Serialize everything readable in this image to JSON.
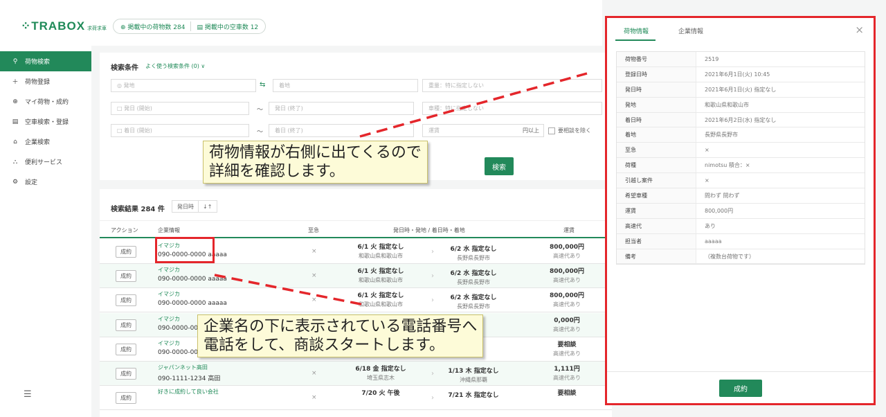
{
  "app": {
    "logo": "TRABOX",
    "logo_sub": "求荷求車"
  },
  "stats": {
    "cargo": "掲載中の荷物数 284",
    "trucks": "掲載中の空車数 12"
  },
  "sidebar": {
    "items": [
      {
        "label": "荷物検索",
        "icon": "search-icon",
        "active": true
      },
      {
        "label": "荷物登録",
        "icon": "plus-icon"
      },
      {
        "label": "マイ荷物・成約",
        "icon": "box-icon"
      },
      {
        "label": "空車検索・登録",
        "icon": "truck-icon"
      },
      {
        "label": "企業検索",
        "icon": "home-icon"
      },
      {
        "label": "便利サービス",
        "icon": "people-icon"
      },
      {
        "label": "設定",
        "icon": "gear-icon"
      }
    ]
  },
  "search": {
    "title": "検索条件",
    "saved_link": "よく使う検索条件 (0) ∨",
    "origin_ph": "◎ 発地",
    "dest_ph": "着地",
    "weight_ph": "重量：特に指定しない",
    "dep_start_ph": "□ 発日 (開始)",
    "dep_end_ph": "発日 (終了)",
    "vehicle_ph": "車種：特に指定しない",
    "arr_start_ph": "□ 着日 (開始)",
    "arr_end_ph": "着日 (終了)",
    "fare_ph": "運賃",
    "fare_unit": "円以上",
    "exclude_label": "要相談を除く",
    "search_btn": "検索",
    "tilde": "～",
    "swap": "⇆"
  },
  "results": {
    "title": "検索結果 284 件",
    "sort_label": "発日時",
    "sort_icon": "↓↑",
    "columns": {
      "action": "アクション",
      "company": "企業情報",
      "urgent": "至急",
      "route": "発日時・発地 / 着日時・着地",
      "fare": "運賃"
    },
    "rows": [
      {
        "btn": "成約",
        "company": "イマジカ",
        "phone": "090-0000-0000 aaaaa",
        "urgent": "×",
        "dep_date": "6/1 火 指定なし",
        "dep_place": "和歌山県和歌山市",
        "arr_date": "6/2 水 指定なし",
        "arr_place": "長野県長野市",
        "fare": "800,000円",
        "sub": "高速代あり"
      },
      {
        "btn": "成約",
        "company": "イマジカ",
        "phone": "090-0000-0000 aaaaa",
        "urgent": "×",
        "dep_date": "6/1 火 指定なし",
        "dep_place": "和歌山県和歌山市",
        "arr_date": "6/2 水 指定なし",
        "arr_place": "長野県長野市",
        "fare": "800,000円",
        "sub": "高速代あり"
      },
      {
        "btn": "成約",
        "company": "イマジカ",
        "phone": "090-0000-0000 aaaaa",
        "urgent": "×",
        "dep_date": "6/1 火 指定なし",
        "dep_place": "和歌山県和歌山市",
        "arr_date": "6/2 水 指定なし",
        "arr_place": "長野県長野市",
        "fare": "800,000円",
        "sub": "高速代あり"
      },
      {
        "btn": "成約",
        "company": "イマジカ",
        "phone": "090-0000-00",
        "urgent": "",
        "dep_date": "",
        "dep_place": "",
        "arr_date": "",
        "arr_place": "",
        "fare": "0,000円",
        "sub": "高速代あり"
      },
      {
        "btn": "成約",
        "company": "イマジカ",
        "phone": "090-0000-00",
        "urgent": "",
        "dep_date": "",
        "dep_place": "",
        "arr_date": "",
        "arr_place": "",
        "fare": "要相談",
        "sub": "高速代あり"
      },
      {
        "btn": "成約",
        "company": "ジャパンネット高田",
        "phone": "090-1111-1234 高田",
        "urgent": "×",
        "dep_date": "6/18 金 指定なし",
        "dep_place": "埼玉県志木",
        "arr_date": "1/13 木 指定なし",
        "arr_place": "沖縄県那覇",
        "fare": "1,111円",
        "sub": "高速代あり"
      },
      {
        "btn": "成約",
        "company": "好きに成約して良い会社",
        "phone": "",
        "urgent": "×",
        "dep_date": "7/20 火 午後",
        "dep_place": "",
        "arr_date": "7/21 水 指定なし",
        "arr_place": "",
        "fare": "要相談",
        "sub": ""
      }
    ]
  },
  "detail": {
    "tabs": [
      "荷物情報",
      "企業情報"
    ],
    "close": "×",
    "fields": [
      {
        "k": "荷物番号",
        "v": "2519"
      },
      {
        "k": "登録日時",
        "v": "2021年6月1日(火) 10:45"
      },
      {
        "k": "発日時",
        "v": "2021年6月1日(火) 指定なし"
      },
      {
        "k": "発地",
        "v": "和歌山県和歌山市"
      },
      {
        "k": "着日時",
        "v": "2021年6月2日(水) 指定なし"
      },
      {
        "k": "着地",
        "v": "長野県長野市"
      },
      {
        "k": "至急",
        "v": "×"
      },
      {
        "k": "荷種",
        "v": "nimotsu 積合：×"
      },
      {
        "k": "引越し案件",
        "v": "×"
      },
      {
        "k": "希望車種",
        "v": "問わず 問わず"
      },
      {
        "k": "運賃",
        "v": "800,000円"
      },
      {
        "k": "高速代",
        "v": "あり"
      },
      {
        "k": "担当者",
        "v": "aaaaa"
      },
      {
        "k": "備考",
        "v": "（複数台荷物です）"
      }
    ],
    "deal_btn": "成約"
  },
  "annotations": {
    "callout1": [
      "荷物情報が右側に出てくるので",
      "詳細を確認します。"
    ],
    "callout2": [
      "企業名の下に表示されている電話番号へ",
      "電話をして、商談スタートします。"
    ]
  },
  "colors": {
    "brand": "#22895a",
    "highlight": "#e4262b",
    "callout_bg": "#fdfbd8"
  }
}
